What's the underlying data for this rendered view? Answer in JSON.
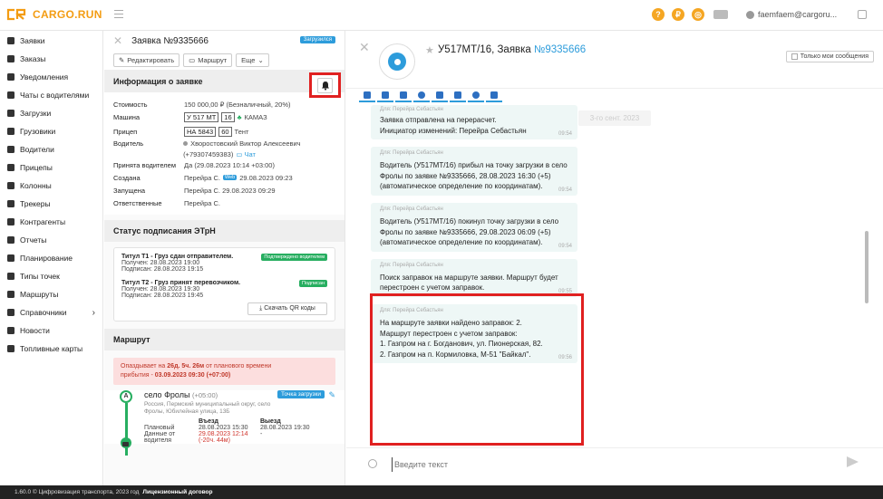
{
  "app": {
    "logo": "CARGO.RUN",
    "user": "faemfaem@cargoru..."
  },
  "header_icons": [
    "help-icon",
    "currency-icon",
    "support-icon",
    "truck-icon"
  ],
  "sidebar": {
    "items": [
      {
        "label": "Заявки",
        "icon": "docs-icon"
      },
      {
        "label": "Заказы",
        "icon": "orders-icon"
      },
      {
        "label": "Уведомления",
        "icon": "bell-icon"
      },
      {
        "label": "Чаты с водителями",
        "icon": "chat-icon"
      },
      {
        "label": "Загрузки",
        "icon": "refresh-icon"
      },
      {
        "label": "Грузовики",
        "icon": "truck-icon"
      },
      {
        "label": "Водители",
        "icon": "driver-icon"
      },
      {
        "label": "Прицепы",
        "icon": "trailer-icon"
      },
      {
        "label": "Колонны",
        "icon": "convoy-icon"
      },
      {
        "label": "Трекеры",
        "icon": "tracker-icon"
      },
      {
        "label": "Контрагенты",
        "icon": "contractors-icon"
      },
      {
        "label": "Отчеты",
        "icon": "reports-icon"
      },
      {
        "label": "Планирование",
        "icon": "planning-icon"
      },
      {
        "label": "Типы точек",
        "icon": "point-types-icon"
      },
      {
        "label": "Маршруты",
        "icon": "routes-icon"
      },
      {
        "label": "Справочники",
        "icon": "reference-icon",
        "chevron": "›"
      },
      {
        "label": "Новости",
        "icon": "news-icon"
      },
      {
        "label": "Топливные карты",
        "icon": "fuel-card-icon"
      }
    ]
  },
  "order": {
    "title": "Заявка №9335666",
    "status_badge": "Загрузился",
    "buttons": {
      "edit": "Редактировать",
      "route": "Маршрут",
      "more": "Еще"
    },
    "info_section": "Информация о заявке",
    "info": {
      "cost_label": "Стоимость",
      "cost": "150 000,00 ₽ (Безналичный, 20%)",
      "truck_label": "Машина",
      "truck_plate": "У 517 МТ",
      "truck_region": "16",
      "truck_brand": "КАМАЗ",
      "trailer_label": "Прицеп",
      "trailer_plate": "НА 5843",
      "trailer_region": "60",
      "trailer_type": "Тент",
      "driver_label": "Водитель",
      "driver_name": "Хворостовский Виктор Алексеевич",
      "driver_phone": "(+79307459383)",
      "driver_chat": "Чат",
      "accepted_label": "Принята водителем",
      "accepted": "Да (29.08.2023 10:14 +03:00)",
      "created_label": "Создана",
      "created_by": "Перейра С.",
      "created_web": "Web",
      "created_at": "29.08.2023 09:23",
      "started_label": "Запущена",
      "started": "Перейра С. 29.08.2023 09:29",
      "responsible_label": "Ответственные",
      "responsible": "Перейра С."
    },
    "edo_section": "Статус подписания ЭТрН",
    "edo": [
      {
        "title": "Титул Т1 - Груз сдан отправителем.",
        "badge": "Подтверждено водителем",
        "received": "Получен: 28.08.2023 19:00",
        "signed": "Подписан: 28.08.2023 19:15"
      },
      {
        "title": "Титул Т2 - Груз принят перевозчиком.",
        "badge": "Подписан",
        "received": "Получен: 28.08.2023 19:30",
        "signed": "Подписан: 28.08.2023 19:45"
      }
    ],
    "qr_button": "Скачать QR коды",
    "route_section": "Маршрут",
    "delay": {
      "line1a": "Опаздывает на",
      "delay": "26д. 5ч. 26м",
      "line1b": "от планового времени",
      "line2a": "прибытия -",
      "eta": "03.09.2023 09:30 (+07:00)"
    },
    "stop": {
      "letter": "A",
      "town": "село Фролы",
      "tz": "(+05:00)",
      "tag": "Точка загрузки",
      "address": "Россия, Пермский муниципальный округ, село Фролы, Юбилейная улица, 13Б",
      "col_entry": "Въезд",
      "col_exit": "Выезд",
      "plan_label": "Плановый",
      "plan_entry": "28.08.2023 15:30",
      "plan_exit": "28.08.2023 19:30",
      "actual_label": "Данные от водителя",
      "actual_entry": "29.08.2023 12:14",
      "actual_delta": "(-20ч. 44м)",
      "actual_exit": "-"
    }
  },
  "chat": {
    "title_prefix": "У517МТ/16, Заявка ",
    "title_link": "№9335666",
    "only_mine": "Только мои сообщения",
    "tool_icons": [
      "assign-icon",
      "settings-icon",
      "edit-icon",
      "info-icon",
      "fuel-icon",
      "flag-icon",
      "clock-icon",
      "wrench-icon"
    ],
    "date_pill": "3-го сент. 2023",
    "messages": [
      {
        "who": "Для: Перейра Себастьян",
        "text": "Заявка отправлена на перерасчет.\nИнициатор изменений: Перейра Себастьян",
        "time": "09:54"
      },
      {
        "who": "Для: Перейра Себастьян",
        "text": "Водитель (У517МТ/16) прибыл на точку загрузки в село Фролы по заявке №9335666, 28.08.2023 16:30 (+5) (автоматическое определение по координатам).",
        "time": "09:54"
      },
      {
        "who": "Для: Перейра Себастьян",
        "text": "Водитель (У517МТ/16) покинул точку загрузки в село Фролы по заявке №9335666, 29.08.2023 06:09 (+5) (автоматическое определение по координатам).",
        "time": "09:54"
      },
      {
        "who": "Для: Перейра Себастьян",
        "text": "Поиск заправок на маршруте заявки. Маршрут будет перестроен с учетом заправок.",
        "time": "09:55"
      },
      {
        "who": "Для: Перейра Себастьян",
        "text": "На маршруте заявки найдено заправок: 2.\nМаршрут перестроен с учетом заправок:\n        1. Газпром на г. Богданович, ул. Пионерская, 82.\n        2. Газпром на п. Кормиловка, М-51 \"Байкал\".",
        "time": "09:56"
      }
    ],
    "input_placeholder": "Введите текст"
  },
  "footer": {
    "text": "1.60.0 © Цифровизация транспорта, 2023 год",
    "license": "Лицензионный договор"
  },
  "colors": {
    "accent": "#f39c12",
    "link": "#2d9cdb",
    "highlight": "#e02020",
    "success": "#27ae60",
    "bubble": "#eef7f6"
  }
}
